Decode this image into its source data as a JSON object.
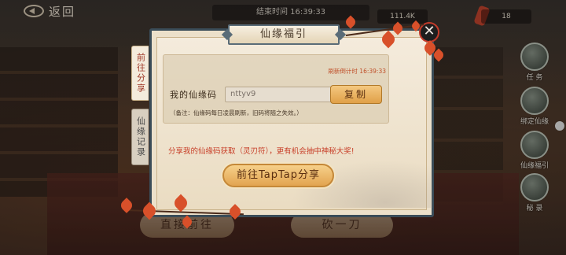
{
  "topbar": {
    "back_label": "返回",
    "end_time": "结束时间  16:39:33",
    "currency_1": "111.4K",
    "currency_2": "18"
  },
  "dialog": {
    "title": "仙缘福引",
    "close_symbol": "✕",
    "tabs": [
      {
        "label": "前往分享",
        "active": true
      },
      {
        "label": "仙缘记录",
        "active": false
      }
    ],
    "refresh_text": "刷新倒计时  16:39:33",
    "code_label": "我的仙缘码",
    "code_value": "nttyv9",
    "copy_label": "复制",
    "note": "（备注：仙缘码每日凌晨刷新，旧码将随之失效。）",
    "share_desc": "分享我的仙缘码获取（灵刃符），更有机会抽中神秘大奖!",
    "share_button": "前往TapTap分享"
  },
  "side_menu": [
    {
      "label": "任 务",
      "icon": "task-icon"
    },
    {
      "label": "绑定仙缘",
      "icon": "bind-icon"
    },
    {
      "label": "仙缘福引",
      "icon": "scroll-icon"
    },
    {
      "label": "秘 录",
      "icon": "book-icon"
    }
  ],
  "bottom_buttons": [
    {
      "label": "直接前往"
    },
    {
      "label": "砍一刀"
    }
  ],
  "colors": {
    "accent_red": "#c8402a",
    "button_gold": "#e2a450",
    "frame_blue": "#3a4c58",
    "paper": "#f4ebdc"
  }
}
